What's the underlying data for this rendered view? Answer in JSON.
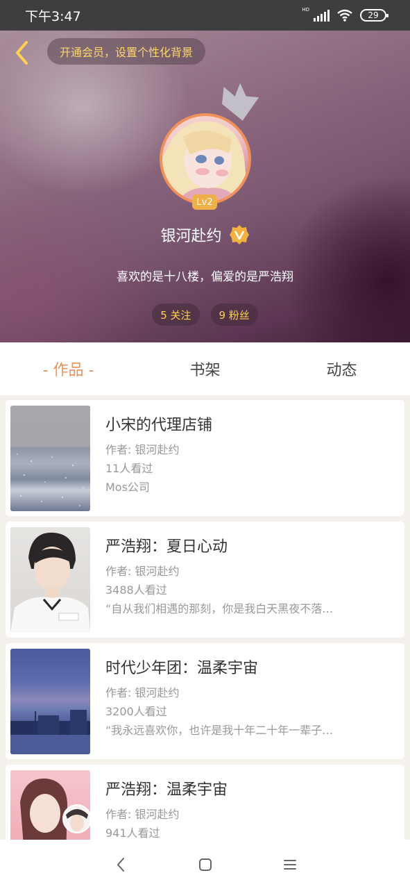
{
  "status_bar": {
    "time": "下午3:47",
    "battery": "29",
    "network_label": "HD"
  },
  "header": {
    "vip_banner": "开通会员，设置个性化背景",
    "level": "Lv2",
    "username": "银河赴约",
    "bio": "喜欢的是十八楼，偏爱的是严浩翔",
    "following": "5 关注",
    "followers": "9 粉丝"
  },
  "tabs": [
    {
      "label": "- 作品 -",
      "active": true
    },
    {
      "label": "书架",
      "active": false
    },
    {
      "label": "动态",
      "active": false
    }
  ],
  "works": [
    {
      "title": "小宋的代理店铺",
      "author": "作者: 银河赴约",
      "views": "11人看过",
      "desc": "Mos公司"
    },
    {
      "title": "严浩翔：夏日心动",
      "author": "作者: 银河赴约",
      "views": "3488人看过",
      "desc": "“自从我们相遇的那刻，你是我白天黑夜不落…"
    },
    {
      "title": "时代少年团：温柔宇宙",
      "author": "作者: 银河赴约",
      "views": "3200人看过",
      "desc": "“我永远喜欢你，也许是我十年二十年一辈子…"
    },
    {
      "title": "严浩翔：温柔宇宙",
      "author": "作者: 银河赴约",
      "views": "941人看过",
      "desc": ""
    }
  ],
  "colors": {
    "accent": "#e8935d",
    "gold": "#ffd24d",
    "avatar_ring": "#f0905a"
  }
}
